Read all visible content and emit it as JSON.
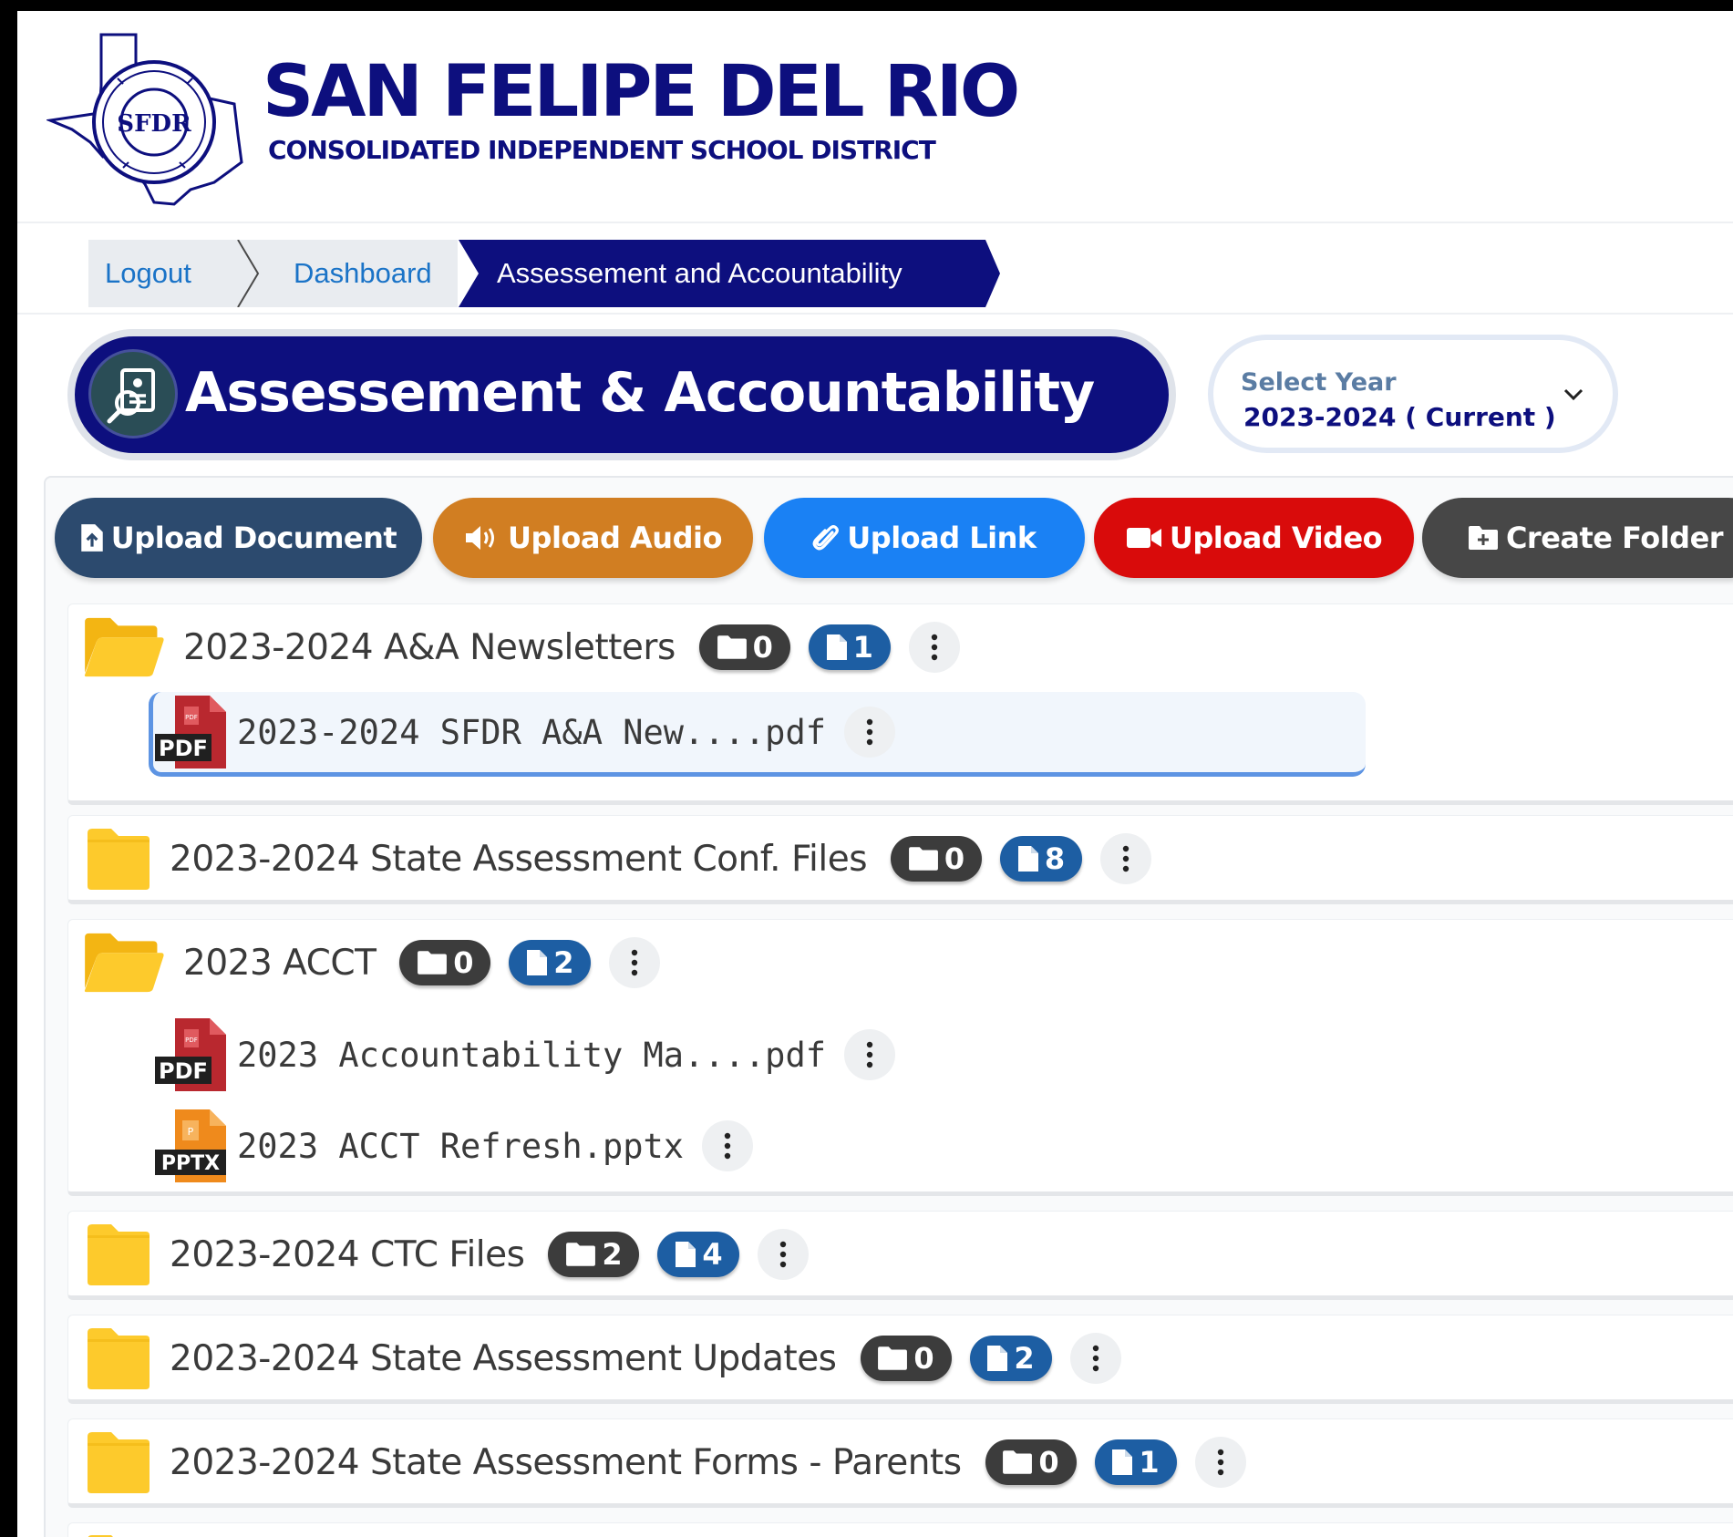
{
  "brand": {
    "title": "SAN FELIPE DEL RIO",
    "subtitle": "CONSOLIDATED INDEPENDENT SCHOOL DISTRICT",
    "logo_text": "SFDR"
  },
  "breadcrumb": {
    "logout": "Logout",
    "dashboard": "Dashboard",
    "current": "Assessement and Accountability"
  },
  "page": {
    "title": "Assessement & Accountability"
  },
  "year_select": {
    "label": "Select Year",
    "value": "2023-2024 ( Current )"
  },
  "actions": [
    {
      "label": "Upload Document",
      "icon": "file-upload-icon",
      "color": "#2c4a6e"
    },
    {
      "label": "Upload Audio",
      "icon": "volume-icon",
      "color": "#d17e22"
    },
    {
      "label": "Upload Link",
      "icon": "paperclip-icon",
      "color": "#1a81f4"
    },
    {
      "label": "Upload Video",
      "icon": "video-camera-icon",
      "color": "#d90b0b"
    },
    {
      "label": "Create Folder",
      "icon": "folder-plus-icon",
      "color": "#474747"
    }
  ],
  "folders": [
    {
      "name": "2023-2024 A&A Newsletters",
      "folder_count": "0",
      "file_count": "1",
      "open": true,
      "files": [
        {
          "name": "2023-2024 SFDR A&A New....pdf",
          "type": "PDF",
          "selected": true
        }
      ]
    },
    {
      "name": "2023-2024 State Assessment Conf. Files",
      "folder_count": "0",
      "file_count": "8",
      "open": false,
      "files": []
    },
    {
      "name": "2023 ACCT",
      "folder_count": "0",
      "file_count": "2",
      "open": true,
      "files": [
        {
          "name": "2023 Accountability Ma....pdf",
          "type": "PDF"
        },
        {
          "name": "2023 ACCT Refresh.pptx",
          "type": "PPTX"
        }
      ]
    },
    {
      "name": "2023-2024 CTC Files",
      "folder_count": "2",
      "file_count": "4",
      "open": false,
      "files": []
    },
    {
      "name": "2023-2024 State Assessment Updates",
      "folder_count": "0",
      "file_count": "2",
      "open": false,
      "files": []
    },
    {
      "name": "2023-2024 State Assessment Forms - Parents",
      "folder_count": "0",
      "file_count": "1",
      "open": false,
      "files": []
    }
  ],
  "colors": {
    "brand_navy": "#0d0f7e",
    "folder_yellow": "#fdca2c",
    "badge_folder": "#3c3c3c",
    "badge_file": "#1d5ea3",
    "pdf_red": "#b9282f",
    "pptx_orange": "#ef8a1c"
  }
}
